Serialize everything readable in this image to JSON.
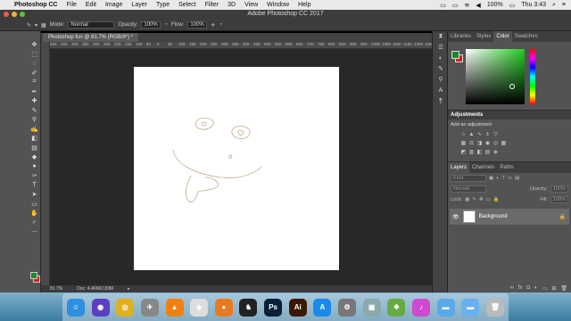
{
  "menubar": {
    "app": "Photoshop CC",
    "items": [
      "File",
      "Edit",
      "Image",
      "Layer",
      "Type",
      "Select",
      "Filter",
      "3D",
      "View",
      "Window",
      "Help"
    ],
    "battery": "100%",
    "clock": "Thu 3:43"
  },
  "window": {
    "title": "Adobe Photoshop CC 2017"
  },
  "options": {
    "mode_label": "Mode:",
    "mode_value": "Normal",
    "opacity_label": "Opacity:",
    "opacity_value": "100%",
    "flow_label": "Flow:",
    "flow_value": "100%"
  },
  "document": {
    "tab": "Photoshop fun @ 81.7% (RGB/8*) *",
    "zoom": "81.7%",
    "doc_size": "Doc: 4.46M/2.83M"
  },
  "ruler": {
    "ticks": [
      "500",
      "450",
      "400",
      "350",
      "300",
      "250",
      "200",
      "150",
      "100",
      "50",
      "0",
      "50",
      "100",
      "150",
      "200",
      "250",
      "300",
      "350",
      "400",
      "450",
      "500",
      "550",
      "600",
      "650",
      "700",
      "750",
      "800",
      "850",
      "900",
      "950",
      "1000",
      "1050",
      "1100",
      "1150",
      "1200",
      "1250"
    ]
  },
  "panels": {
    "color_tabs": [
      "Libraries",
      "Styles",
      "Color",
      "Swatches"
    ],
    "color_active": "Color",
    "adjustments_title": "Adjustments",
    "adjustments_sub": "Add an adjustment",
    "layer_tabs": [
      "Layers",
      "Channels",
      "Paths"
    ],
    "layers_active": "Layers",
    "kind_label": "Kind",
    "blend_mode": "Normal",
    "opacity_label": "Opacity:",
    "opacity_value": "100%",
    "lock_label": "Lock:",
    "fill_label": "Fill:",
    "fill_value": "100%",
    "layer_name": "Background"
  },
  "colors": {
    "foreground": "#1a8a2a",
    "background": "#d02020"
  },
  "dock": {
    "apps": [
      {
        "icon": "finder-icon",
        "glyph": "☺",
        "color": "#2f8fe0"
      },
      {
        "icon": "siri-icon",
        "glyph": "◉",
        "color": "#5a3fc0"
      },
      {
        "icon": "chrome-icon",
        "glyph": "◎",
        "color": "#e0b020"
      },
      {
        "icon": "launchpad-icon",
        "glyph": "✈",
        "color": "#888"
      },
      {
        "icon": "vlc-icon",
        "glyph": "▲",
        "color": "#f08010"
      },
      {
        "icon": "unity-icon",
        "glyph": "◆",
        "color": "#ddd"
      },
      {
        "icon": "blender-icon",
        "glyph": "●",
        "color": "#e87a20"
      },
      {
        "icon": "cat-app-icon",
        "glyph": "♞",
        "color": "#222"
      },
      {
        "icon": "photoshop-icon",
        "glyph": "Ps",
        "color": "#0a2038"
      },
      {
        "icon": "illustrator-icon",
        "glyph": "Ai",
        "color": "#3a1800"
      },
      {
        "icon": "appstore-icon",
        "glyph": "A",
        "color": "#1a8ae8"
      },
      {
        "icon": "settings-icon",
        "glyph": "⚙",
        "color": "#777"
      },
      {
        "icon": "preview-icon",
        "glyph": "▣",
        "color": "#8aa"
      },
      {
        "icon": "game-icon",
        "glyph": "❖",
        "color": "#6a4"
      },
      {
        "icon": "itunes-icon",
        "glyph": "♪",
        "color": "#d04ad0"
      },
      {
        "icon": "folder-icon",
        "glyph": "▬",
        "color": "#5aa8e8"
      },
      {
        "icon": "downloads-icon",
        "glyph": "▬",
        "color": "#6ab0f0"
      },
      {
        "icon": "trash-icon",
        "glyph": "🗑",
        "color": "#bbb"
      }
    ]
  }
}
